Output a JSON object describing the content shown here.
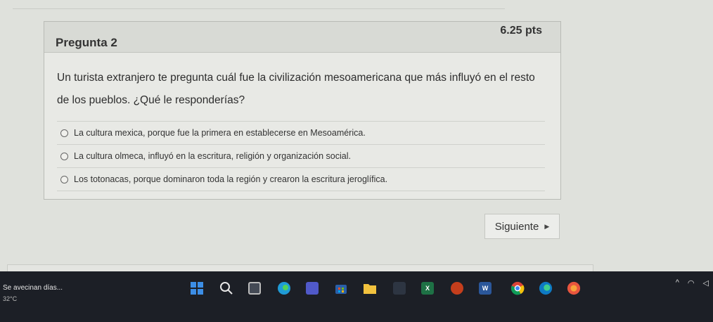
{
  "question": {
    "title": "Pregunta 2",
    "points": "6.25 pts",
    "text": "Un turista extranjero te pregunta cuál fue la civilización mesoamericana que más influyó en el resto de los pueblos. ¿Qué le responderías?",
    "options": [
      "La cultura mexica, porque fue la primera en establecerse en Mesoamérica.",
      "La cultura olmeca, influyó en la escritura, religión y organización social.",
      "Los totonacas, porque dominaron toda la región y crearon la escritura jeroglífica."
    ]
  },
  "navigation": {
    "next_label": "Siguiente"
  },
  "taskbar": {
    "weather_title": "Se avecinan días...",
    "weather_temp": "32°C",
    "icons": [
      "windows-start-icon",
      "search-icon",
      "task-view-icon",
      "edge-icon",
      "teams-icon",
      "store-icon",
      "file-explorer-icon",
      "app-icon",
      "excel-icon",
      "powerpoint-icon",
      "word-icon",
      "chrome-icon",
      "edge-browser-icon",
      "office-icon"
    ],
    "colors": {
      "bar": "#1c1f26",
      "windows": "#3c8ee6",
      "excel": "#1e7145",
      "powerpoint": "#c43e1c",
      "word": "#2b579a",
      "chrome": "#f4c20d",
      "office": "#e8553e"
    }
  }
}
